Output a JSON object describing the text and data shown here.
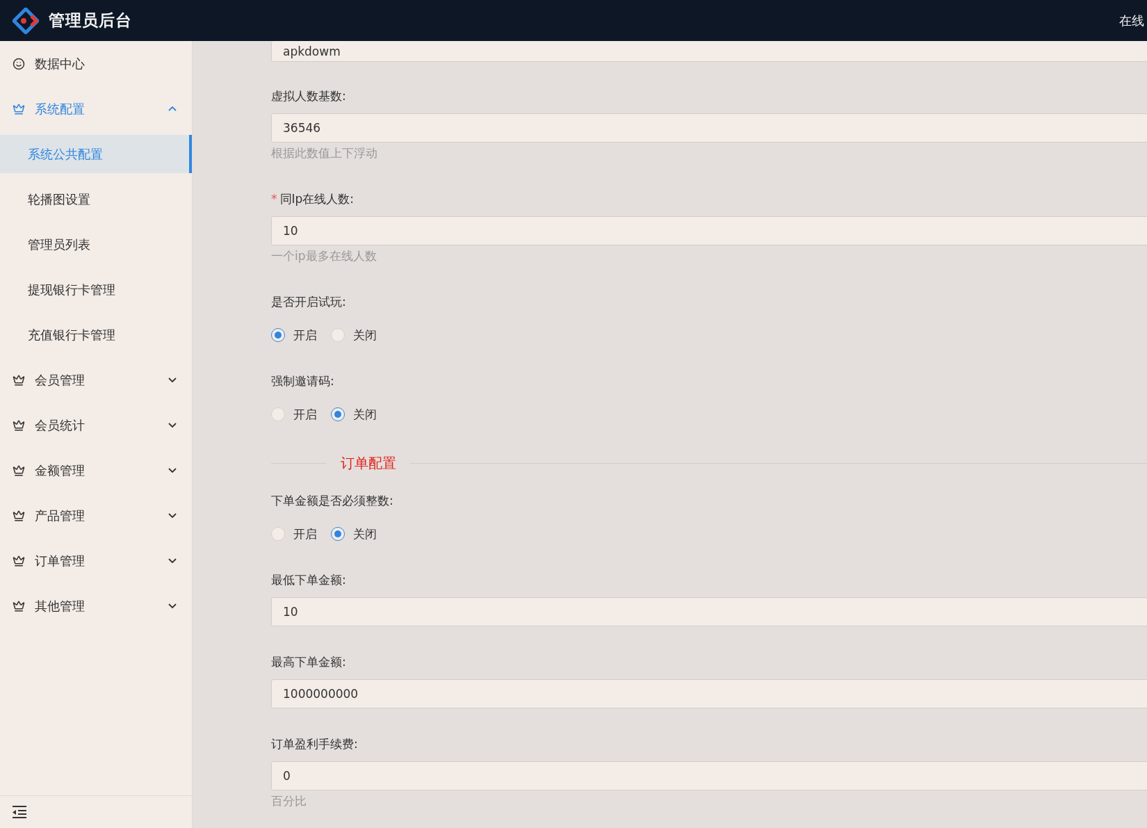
{
  "header": {
    "title": "管理员后台",
    "status": "在线"
  },
  "sidebar": {
    "items": [
      {
        "kind": "link",
        "label": "数据中心"
      },
      {
        "kind": "group",
        "label": "系统配置",
        "expanded": true,
        "children": [
          {
            "label": "系统公共配置",
            "selected": true
          },
          {
            "label": "轮播图设置",
            "selected": false
          },
          {
            "label": "管理员列表",
            "selected": false
          },
          {
            "label": "提现银行卡管理",
            "selected": false
          },
          {
            "label": "充值银行卡管理",
            "selected": false
          }
        ]
      },
      {
        "kind": "group",
        "label": "会员管理",
        "expanded": false
      },
      {
        "kind": "group",
        "label": "会员统计",
        "expanded": false
      },
      {
        "kind": "group",
        "label": "金额管理",
        "expanded": false
      },
      {
        "kind": "group",
        "label": "产品管理",
        "expanded": false
      },
      {
        "kind": "group",
        "label": "订单管理",
        "expanded": false
      },
      {
        "kind": "group",
        "label": "其他管理",
        "expanded": false
      }
    ]
  },
  "form": [
    {
      "kind": "input",
      "value": "apkdowm"
    },
    {
      "kind": "input",
      "label": "虚拟人数基数:",
      "value": "36546",
      "hint": "根据此数值上下浮动"
    },
    {
      "kind": "input",
      "label": "同Ip在线人数:",
      "marker": "*",
      "value": "10",
      "hint": "一个ip最多在线人数"
    },
    {
      "kind": "radio",
      "label": "是否开启试玩:",
      "options": [
        {
          "label": "开启",
          "selected": true
        },
        {
          "label": "关闭",
          "selected": false
        }
      ]
    },
    {
      "kind": "radio",
      "label": "强制邀请码:",
      "options": [
        {
          "label": "开启",
          "selected": false
        },
        {
          "label": "关闭",
          "selected": true
        }
      ]
    },
    {
      "kind": "divider",
      "label": "订单配置"
    },
    {
      "kind": "radio",
      "label": "下单金额是否必须整数:",
      "options": [
        {
          "label": "开启",
          "selected": false
        },
        {
          "label": "关闭",
          "selected": true
        }
      ]
    },
    {
      "kind": "input",
      "label": "最低下单金额:",
      "value": "10"
    },
    {
      "kind": "input",
      "label": "最高下单金额:",
      "value": "1000000000"
    },
    {
      "kind": "input",
      "label": "订单盈利手续费:",
      "value": "0",
      "hint": "百分比"
    }
  ]
}
